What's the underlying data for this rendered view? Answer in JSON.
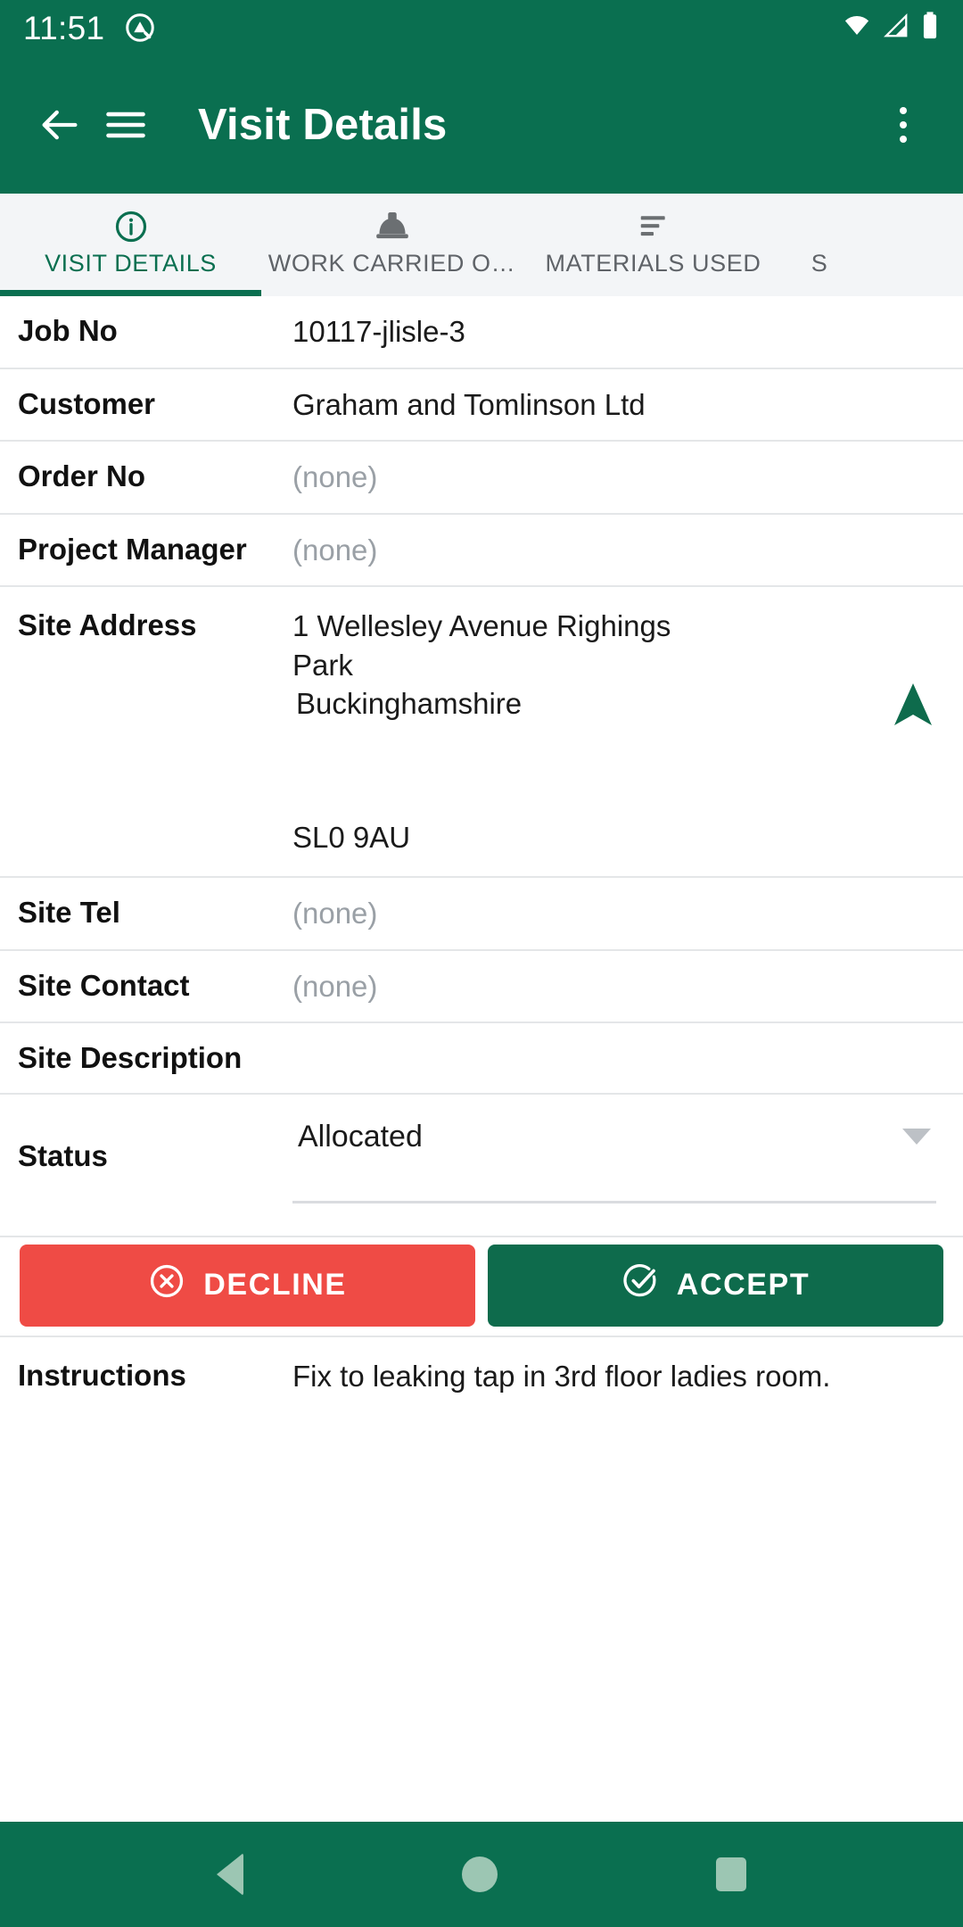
{
  "status_bar": {
    "time": "11:51",
    "app_icon": "quick-settings-icon",
    "wifi_icon": "wifi-icon",
    "signal_icon": "cell-signal-icon",
    "battery_icon": "battery-full-icon"
  },
  "app_bar": {
    "back_icon": "back-arrow-icon",
    "menu_icon": "hamburger-menu-icon",
    "title": "Visit Details",
    "overflow_icon": "overflow-menu-icon"
  },
  "tabs": [
    {
      "label": "VISIT DETAILS",
      "icon": "info-circle-icon",
      "active": true
    },
    {
      "label": "WORK CARRIED O…",
      "icon": "hard-hat-icon",
      "active": false
    },
    {
      "label": "MATERIALS USED",
      "icon": "list-lines-icon",
      "active": false
    },
    {
      "label": "S",
      "icon": "",
      "active": false
    }
  ],
  "details": {
    "job_no": {
      "label": "Job No",
      "value": "10117-jlisle-3",
      "muted": false
    },
    "customer": {
      "label": "Customer",
      "value": "Graham and Tomlinson Ltd",
      "muted": false
    },
    "order_no": {
      "label": "Order No",
      "value": "(none)",
      "muted": true
    },
    "project_manager": {
      "label": "Project Manager",
      "value": "(none)",
      "muted": true
    },
    "site_address": {
      "label": "Site Address",
      "line1": "1 Wellesley Avenue Righings",
      "line2": "Park",
      "line3": "Buckinghamshire",
      "postcode": "SL0 9AU",
      "nav_icon": "navigation-arrow-icon"
    },
    "site_tel": {
      "label": "Site Tel",
      "value": "(none)",
      "muted": true
    },
    "site_contact": {
      "label": "Site Contact",
      "value": "(none)",
      "muted": true
    },
    "site_description": {
      "label": "Site Description",
      "value": ""
    },
    "status": {
      "label": "Status",
      "value": "Allocated",
      "dropdown_icon": "chevron-down-icon"
    },
    "instructions": {
      "label": "Instructions",
      "value": "Fix to leaking tap in 3rd floor ladies room."
    }
  },
  "actions": {
    "decline": {
      "label": "DECLINE",
      "icon": "circle-x-icon"
    },
    "accept": {
      "label": "ACCEPT",
      "icon": "check-circle-icon"
    }
  },
  "nav_bar": {
    "back": "back-triangle-icon",
    "home": "home-circle-icon",
    "recents": "recents-square-icon"
  },
  "colors": {
    "brand_green": "#0A6F50",
    "accept_green": "#0E6B4C",
    "decline_red": "#EF4B45",
    "tab_bg": "#F3F5F7",
    "muted_text": "#9AA0A6",
    "nav_icon": "#9CC6B3"
  }
}
